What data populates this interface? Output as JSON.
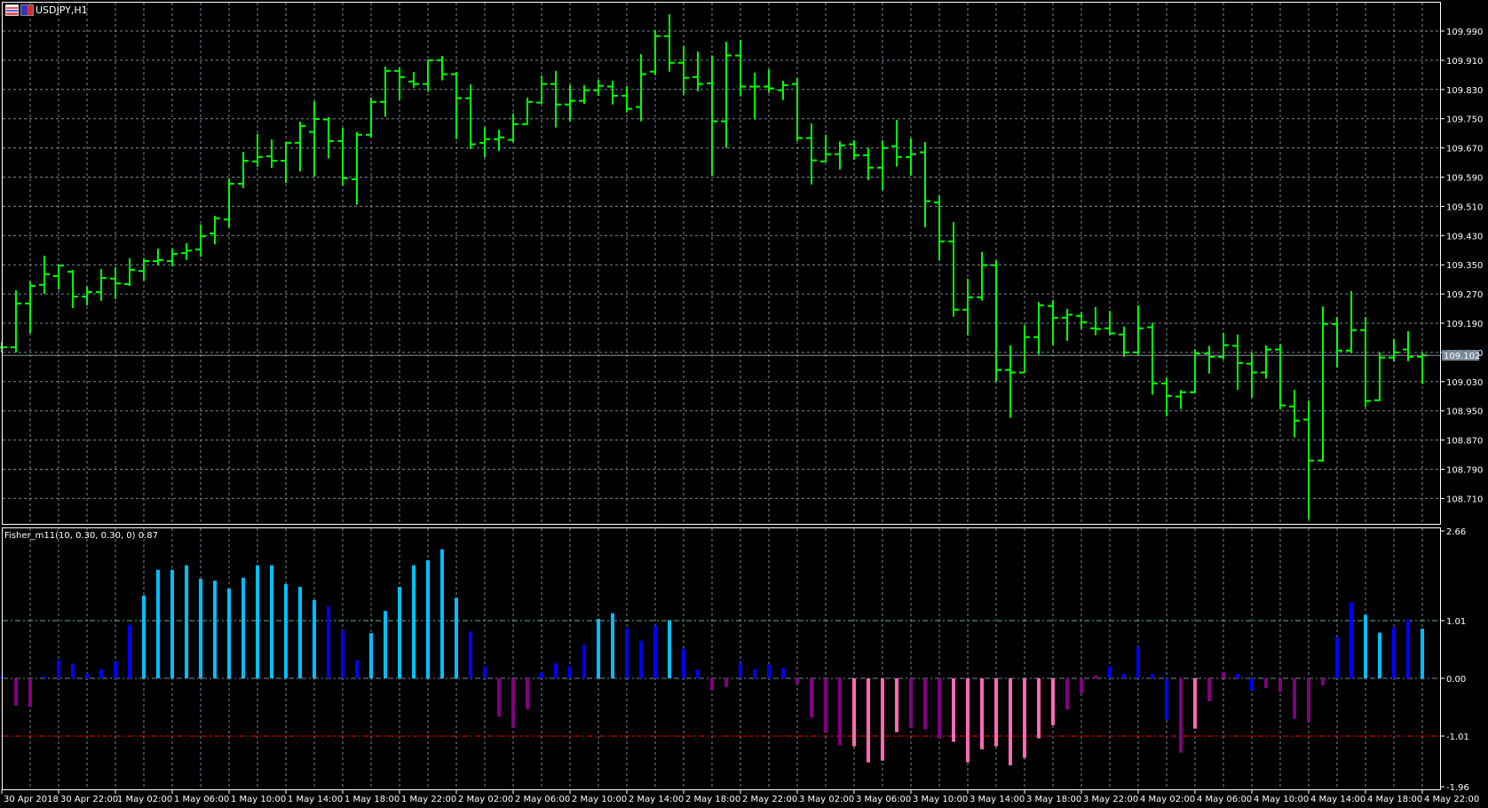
{
  "chart": {
    "symbol_timeframe": "USDJPY,H1",
    "current_price": "109.102"
  },
  "indicator": {
    "label": "Fisher_m11(10, 0.30, 0.30, 0) 0.87",
    "levels": [
      "2.66",
      "1.01",
      "0.00",
      "-1.01",
      "-1.96"
    ]
  },
  "colors": {
    "background": "#000000",
    "bars": "#00FF00",
    "grid": "#778899",
    "frame": "#FFFFFF",
    "level_up": "#5FAF8F",
    "level_down": "#FF0000",
    "fisher": {
      "c": "#00BFFF",
      "b": "#0000FF",
      "p": "#800080",
      "k": "#FF69B4"
    }
  },
  "price_axis": [
    "109.990",
    "109.910",
    "109.830",
    "109.750",
    "109.670",
    "109.590",
    "109.510",
    "109.430",
    "109.350",
    "109.270",
    "109.190",
    "109.110",
    "109.030",
    "108.950",
    "108.870",
    "108.790",
    "108.710"
  ],
  "time_axis": [
    "30 Apr 2018",
    "30 Apr 22:00",
    "1 May 02:00",
    "1 May 06:00",
    "1 May 10:00",
    "1 May 14:00",
    "1 May 18:00",
    "1 May 22:00",
    "2 May 02:00",
    "2 May 06:00",
    "2 May 10:00",
    "2 May 14:00",
    "2 May 18:00",
    "2 May 22:00",
    "3 May 02:00",
    "3 May 06:00",
    "3 May 10:00",
    "3 May 14:00",
    "3 May 18:00",
    "3 May 22:00",
    "4 May 02:00",
    "4 May 06:00",
    "4 May 10:00",
    "4 May 14:00",
    "4 May 18:00",
    "4 May 22:00"
  ],
  "chart_data": {
    "type": "ohlc",
    "ohlc": [
      [
        109.124,
        109.139,
        109.11,
        109.124
      ],
      [
        109.124,
        109.28,
        109.11,
        109.244
      ],
      [
        109.244,
        109.304,
        109.163,
        109.292
      ],
      [
        109.295,
        109.375,
        109.27,
        109.324
      ],
      [
        109.319,
        109.35,
        109.282,
        109.348
      ],
      [
        109.331,
        109.336,
        109.231,
        109.263
      ],
      [
        109.263,
        109.29,
        109.239,
        109.275
      ],
      [
        109.275,
        109.338,
        109.251,
        109.314
      ],
      [
        109.312,
        109.343,
        109.256,
        109.299
      ],
      [
        109.297,
        109.368,
        109.292,
        109.336
      ],
      [
        109.333,
        109.368,
        109.307,
        109.36
      ],
      [
        109.36,
        109.394,
        109.348,
        109.363
      ],
      [
        109.36,
        109.394,
        109.346,
        109.38
      ],
      [
        109.382,
        109.409,
        109.363,
        109.389
      ],
      [
        109.392,
        109.46,
        109.372,
        109.428
      ],
      [
        109.436,
        109.484,
        109.406,
        109.477
      ],
      [
        109.474,
        109.586,
        109.453,
        109.572
      ],
      [
        109.572,
        109.659,
        109.56,
        109.635
      ],
      [
        109.633,
        109.708,
        109.618,
        109.645
      ],
      [
        109.647,
        109.693,
        109.615,
        109.635
      ],
      [
        109.635,
        109.686,
        109.574,
        109.684
      ],
      [
        109.684,
        109.742,
        109.606,
        109.73
      ],
      [
        109.714,
        109.798,
        109.591,
        109.749
      ],
      [
        109.748,
        109.754,
        109.641,
        109.689
      ],
      [
        109.689,
        109.725,
        109.567,
        109.587
      ],
      [
        109.584,
        109.714,
        109.514,
        109.706
      ],
      [
        109.706,
        109.808,
        109.699,
        109.796
      ],
      [
        109.796,
        109.893,
        109.755,
        109.881
      ],
      [
        109.881,
        109.89,
        109.801,
        109.864
      ],
      [
        109.852,
        109.878,
        109.835,
        109.845
      ],
      [
        109.845,
        109.912,
        109.824,
        109.91
      ],
      [
        109.91,
        109.922,
        109.855,
        109.872
      ],
      [
        109.872,
        109.878,
        109.694,
        109.806
      ],
      [
        109.806,
        109.844,
        109.667,
        109.68
      ],
      [
        109.684,
        109.727,
        109.645,
        109.694
      ],
      [
        109.694,
        109.72,
        109.662,
        109.699
      ],
      [
        109.692,
        109.764,
        109.686,
        109.735
      ],
      [
        109.735,
        109.808,
        109.733,
        109.796
      ],
      [
        109.794,
        109.868,
        109.791,
        109.845
      ],
      [
        109.845,
        109.881,
        109.726,
        109.789
      ],
      [
        109.789,
        109.842,
        109.743,
        109.799
      ],
      [
        109.799,
        109.842,
        109.791,
        109.828
      ],
      [
        109.828,
        109.856,
        109.813,
        109.84
      ],
      [
        109.838,
        109.854,
        109.789,
        109.813
      ],
      [
        109.813,
        109.839,
        109.767,
        109.777
      ],
      [
        109.782,
        109.927,
        109.743,
        109.872
      ],
      [
        109.879,
        109.992,
        109.869,
        109.976
      ],
      [
        109.976,
        110.036,
        109.879,
        109.903
      ],
      [
        109.903,
        109.949,
        109.816,
        109.862
      ],
      [
        109.864,
        109.934,
        109.825,
        109.845
      ],
      [
        109.847,
        109.923,
        109.594,
        109.743
      ],
      [
        109.743,
        109.961,
        109.67,
        109.923
      ],
      [
        109.923,
        109.966,
        109.811,
        109.838
      ],
      [
        109.838,
        109.876,
        109.748,
        109.838
      ],
      [
        109.838,
        109.885,
        109.821,
        109.833
      ],
      [
        109.828,
        109.854,
        109.801,
        109.842
      ],
      [
        109.845,
        109.862,
        109.689,
        109.697
      ],
      [
        109.697,
        109.737,
        109.57,
        109.636
      ],
      [
        109.633,
        109.706,
        109.631,
        109.653
      ],
      [
        109.653,
        109.688,
        109.611,
        109.677
      ],
      [
        109.68,
        109.691,
        109.638,
        109.65
      ],
      [
        109.65,
        109.671,
        109.582,
        109.616
      ],
      [
        109.616,
        109.691,
        109.555,
        109.67
      ],
      [
        109.675,
        109.747,
        109.619,
        109.645
      ],
      [
        109.645,
        109.696,
        109.594,
        109.653
      ],
      [
        109.658,
        109.686,
        109.453,
        109.524
      ],
      [
        109.521,
        109.54,
        109.362,
        109.414
      ],
      [
        109.414,
        109.467,
        109.208,
        109.227
      ],
      [
        109.227,
        109.312,
        109.157,
        109.261
      ],
      [
        109.261,
        109.385,
        109.252,
        109.349
      ],
      [
        109.349,
        109.362,
        109.03,
        109.062
      ],
      [
        109.062,
        109.129,
        108.931,
        109.055
      ],
      [
        109.055,
        109.185,
        109.054,
        109.152
      ],
      [
        109.152,
        109.248,
        109.104,
        109.239
      ],
      [
        109.237,
        109.253,
        109.13,
        109.205
      ],
      [
        109.205,
        109.229,
        109.142,
        109.213
      ],
      [
        109.21,
        109.22,
        109.174,
        109.193
      ],
      [
        109.176,
        109.234,
        109.157,
        109.174
      ],
      [
        109.176,
        109.224,
        109.157,
        109.162
      ],
      [
        109.159,
        109.181,
        109.098,
        109.11
      ],
      [
        109.11,
        109.239,
        109.104,
        109.176
      ],
      [
        109.179,
        109.191,
        108.994,
        109.025
      ],
      [
        109.025,
        109.04,
        108.935,
        108.991
      ],
      [
        108.989,
        109.007,
        108.955,
        109.001
      ],
      [
        109.001,
        109.118,
        108.999,
        109.107
      ],
      [
        109.107,
        109.128,
        109.052,
        109.098
      ],
      [
        109.098,
        109.164,
        109.091,
        109.13
      ],
      [
        109.128,
        109.159,
        109.008,
        109.081
      ],
      [
        109.079,
        109.11,
        108.986,
        109.055
      ],
      [
        109.055,
        109.129,
        109.038,
        109.118
      ],
      [
        109.118,
        109.132,
        108.955,
        108.965
      ],
      [
        108.962,
        109.008,
        108.877,
        108.923
      ],
      [
        108.926,
        108.978,
        108.653,
        108.814
      ],
      [
        108.814,
        109.236,
        108.811,
        109.188
      ],
      [
        109.188,
        109.207,
        109.069,
        109.115
      ],
      [
        109.115,
        109.278,
        109.108,
        109.171
      ],
      [
        109.171,
        109.207,
        108.96,
        108.977
      ],
      [
        108.979,
        109.11,
        108.977,
        109.096
      ],
      [
        109.096,
        109.146,
        109.086,
        109.11
      ],
      [
        109.118,
        109.168,
        109.086,
        109.098
      ],
      [
        109.098,
        109.11,
        109.023,
        109.102
      ]
    ],
    "price_range": [
      108.64,
      110.07
    ],
    "fisher": [
      0.03,
      -0.48,
      -0.5,
      0.04,
      0.32,
      0.26,
      0.08,
      0.16,
      0.29,
      0.94,
      1.45,
      1.9,
      1.9,
      1.98,
      1.74,
      1.71,
      1.57,
      1.76,
      1.98,
      1.98,
      1.65,
      1.6,
      1.37,
      1.26,
      0.84,
      0.32,
      0.79,
      1.18,
      1.6,
      1.98,
      2.07,
      2.26,
      1.41,
      0.82,
      0.21,
      -0.67,
      -0.86,
      -0.54,
      0.1,
      0.26,
      0.21,
      0.59,
      1.04,
      1.14,
      0.88,
      0.66,
      0.92,
      1.02,
      0.52,
      0.15,
      -0.21,
      -0.15,
      0.27,
      0.16,
      0.24,
      0.18,
      -0.09,
      -0.69,
      -0.95,
      -1.17,
      -1.19,
      -1.47,
      -1.44,
      -0.94,
      -0.86,
      -0.89,
      -1.05,
      -1.11,
      -1.47,
      -1.24,
      -1.19,
      -1.52,
      -1.39,
      -1.05,
      -0.82,
      -0.55,
      -0.26,
      0.05,
      0.21,
      0.08,
      0.55,
      0.08,
      -0.73,
      -1.3,
      -0.88,
      -0.4,
      0.11,
      0.08,
      -0.21,
      -0.17,
      -0.24,
      -0.71,
      -0.77,
      -0.12,
      0.72,
      1.33,
      1.11,
      0.8,
      0.89,
      1.03,
      0.87
    ],
    "fisher_colors": "bppbbbbbbbcccccccccccccbbbcccccccbbpppbbbbccbbbcbbppbbbbppppkkkkpppkkkkkkkkpppbbbbbpkppbbpppppbbccbbcb",
    "fisher_range": [
      -1.96,
      2.66
    ],
    "levels": [
      1.01,
      0,
      -1.01
    ]
  }
}
